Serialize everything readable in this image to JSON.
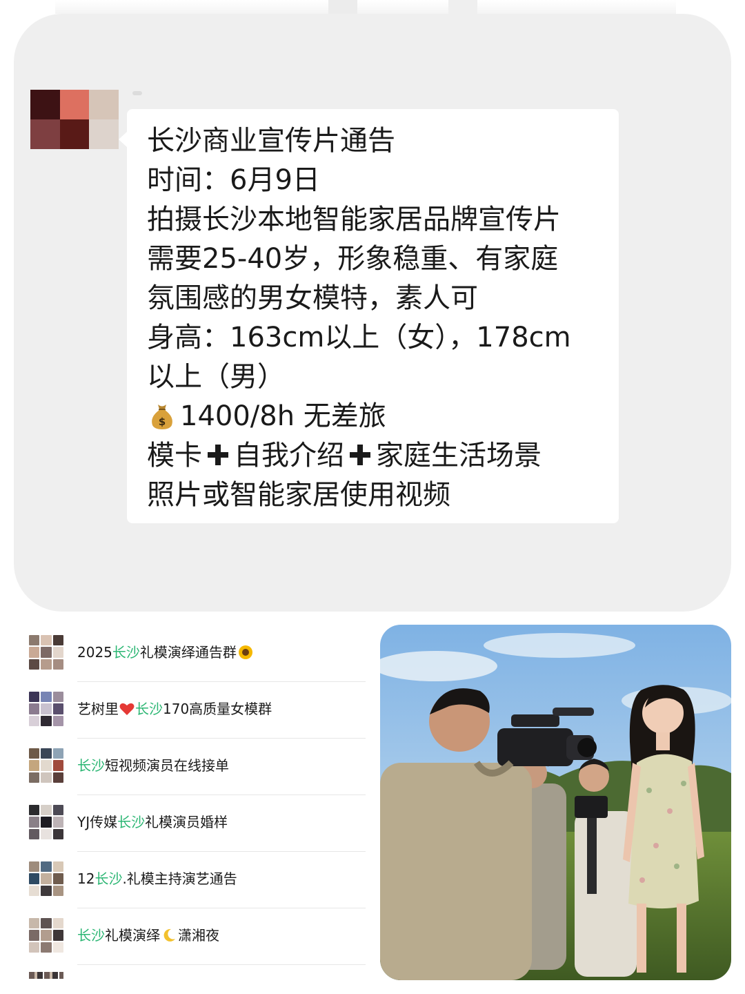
{
  "message": {
    "lines": [
      "长沙商业宣传片通告",
      "时间：6月9日",
      "拍摄长沙本地智能家居品牌宣传片",
      "需要25-40岁，形象稳重、有家庭",
      "氛围感的男女模特，素人可",
      "身高：163cm以上（女），178cm",
      "以上（男）"
    ],
    "pay_text": "1400/8h 无差旅",
    "requirement_parts": [
      "模卡",
      "自我介绍",
      "家庭生活场景"
    ],
    "requirement_last_line": "照片或智能家居使用视频",
    "moneybag_icon": "money-bag-emoji",
    "plus_icon": "heavy-plus-emoji"
  },
  "groups": [
    {
      "prefix": "2025",
      "highlight": "长沙",
      "suffix": "礼模演绎通告群",
      "emoji": "sunflower"
    },
    {
      "prefix": "艺树里",
      "heart": true,
      "highlight": "长沙",
      "suffix": "170高质量女模群"
    },
    {
      "prefix": "",
      "highlight": "长沙",
      "suffix": "短视频演员在线接单"
    },
    {
      "prefix": "YJ传媒",
      "highlight": "长沙",
      "suffix": "礼模演员婚样"
    },
    {
      "prefix": "12",
      "highlight": "长沙",
      "suffix": ".礼模主持演艺通告"
    },
    {
      "prefix": "",
      "highlight": "长沙",
      "suffix": "礼模演绎",
      "moon": true,
      "suffix2": "潇湘夜"
    }
  ],
  "colors": {
    "panel_bg": "#efefef",
    "bubble_bg": "#ffffff",
    "highlight_green": "#2bb673",
    "text": "#1a1a1a"
  }
}
